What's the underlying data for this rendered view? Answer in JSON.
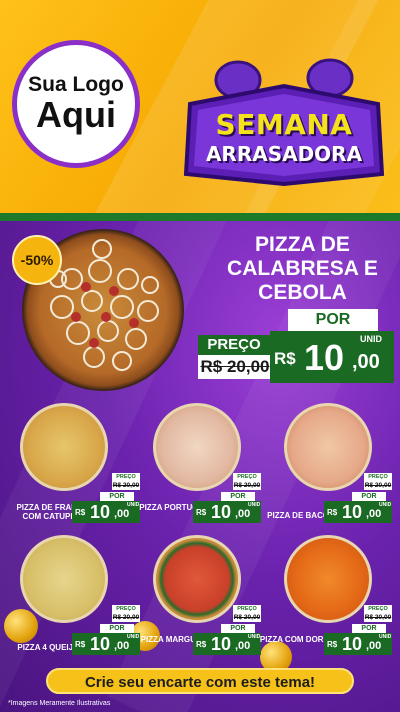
{
  "logo": {
    "line1": "Sua Logo",
    "line2": "Aqui"
  },
  "badge": {
    "line1": "SEMANA",
    "line2": "ARRASADORA"
  },
  "hero": {
    "discount": "-50%",
    "title_line1": "PIZZA DE",
    "title_line2": "CALABRESA E",
    "title_line3": "CEBOLA",
    "por": "POR",
    "preco_label": "PREÇO",
    "old_price": "R$ 20,00",
    "currency": "R$",
    "price_int": "10",
    "price_dec": ",00",
    "unit": "UNID"
  },
  "items": [
    {
      "name": "PIZZA DE FRANGO COM CATUPIRY",
      "preco": "PREÇO",
      "old": "R$ 20,00",
      "por": "POR",
      "currency": "R$",
      "int": "10",
      "dec": ",00",
      "unit": "UNID"
    },
    {
      "name": "PIZZA PORTUGUESA",
      "preco": "PREÇO",
      "old": "R$ 20,00",
      "por": "POR",
      "currency": "R$",
      "int": "10",
      "dec": ",00",
      "unit": "UNID"
    },
    {
      "name": "PIZZA DE BACON",
      "preco": "PREÇO",
      "old": "R$ 20,00",
      "por": "POR",
      "currency": "R$",
      "int": "10",
      "dec": ",00",
      "unit": "UNID"
    },
    {
      "name": "PIZZA 4 QUEIJOS",
      "preco": "PREÇO",
      "old": "R$ 20,00",
      "por": "POR",
      "currency": "R$",
      "int": "10",
      "dec": ",00",
      "unit": "UNID"
    },
    {
      "name": "PIZZA MARGUERITA",
      "preco": "PREÇO",
      "old": "R$ 20,00",
      "por": "POR",
      "currency": "R$",
      "int": "10",
      "dec": ",00",
      "unit": "UNID"
    },
    {
      "name": "PIZZA COM DORITOS",
      "preco": "PREÇO",
      "old": "R$ 20,00",
      "por": "POR",
      "currency": "R$",
      "int": "10",
      "dec": ",00",
      "unit": "UNID"
    }
  ],
  "cta": "Crie seu encarte com este tema!",
  "footnote": "*Imagens Meramente Ilustrativas",
  "colors": {
    "accent_yellow": "#ffc21a",
    "purple": "#6a22ad",
    "price_green": "#1b6a24"
  }
}
